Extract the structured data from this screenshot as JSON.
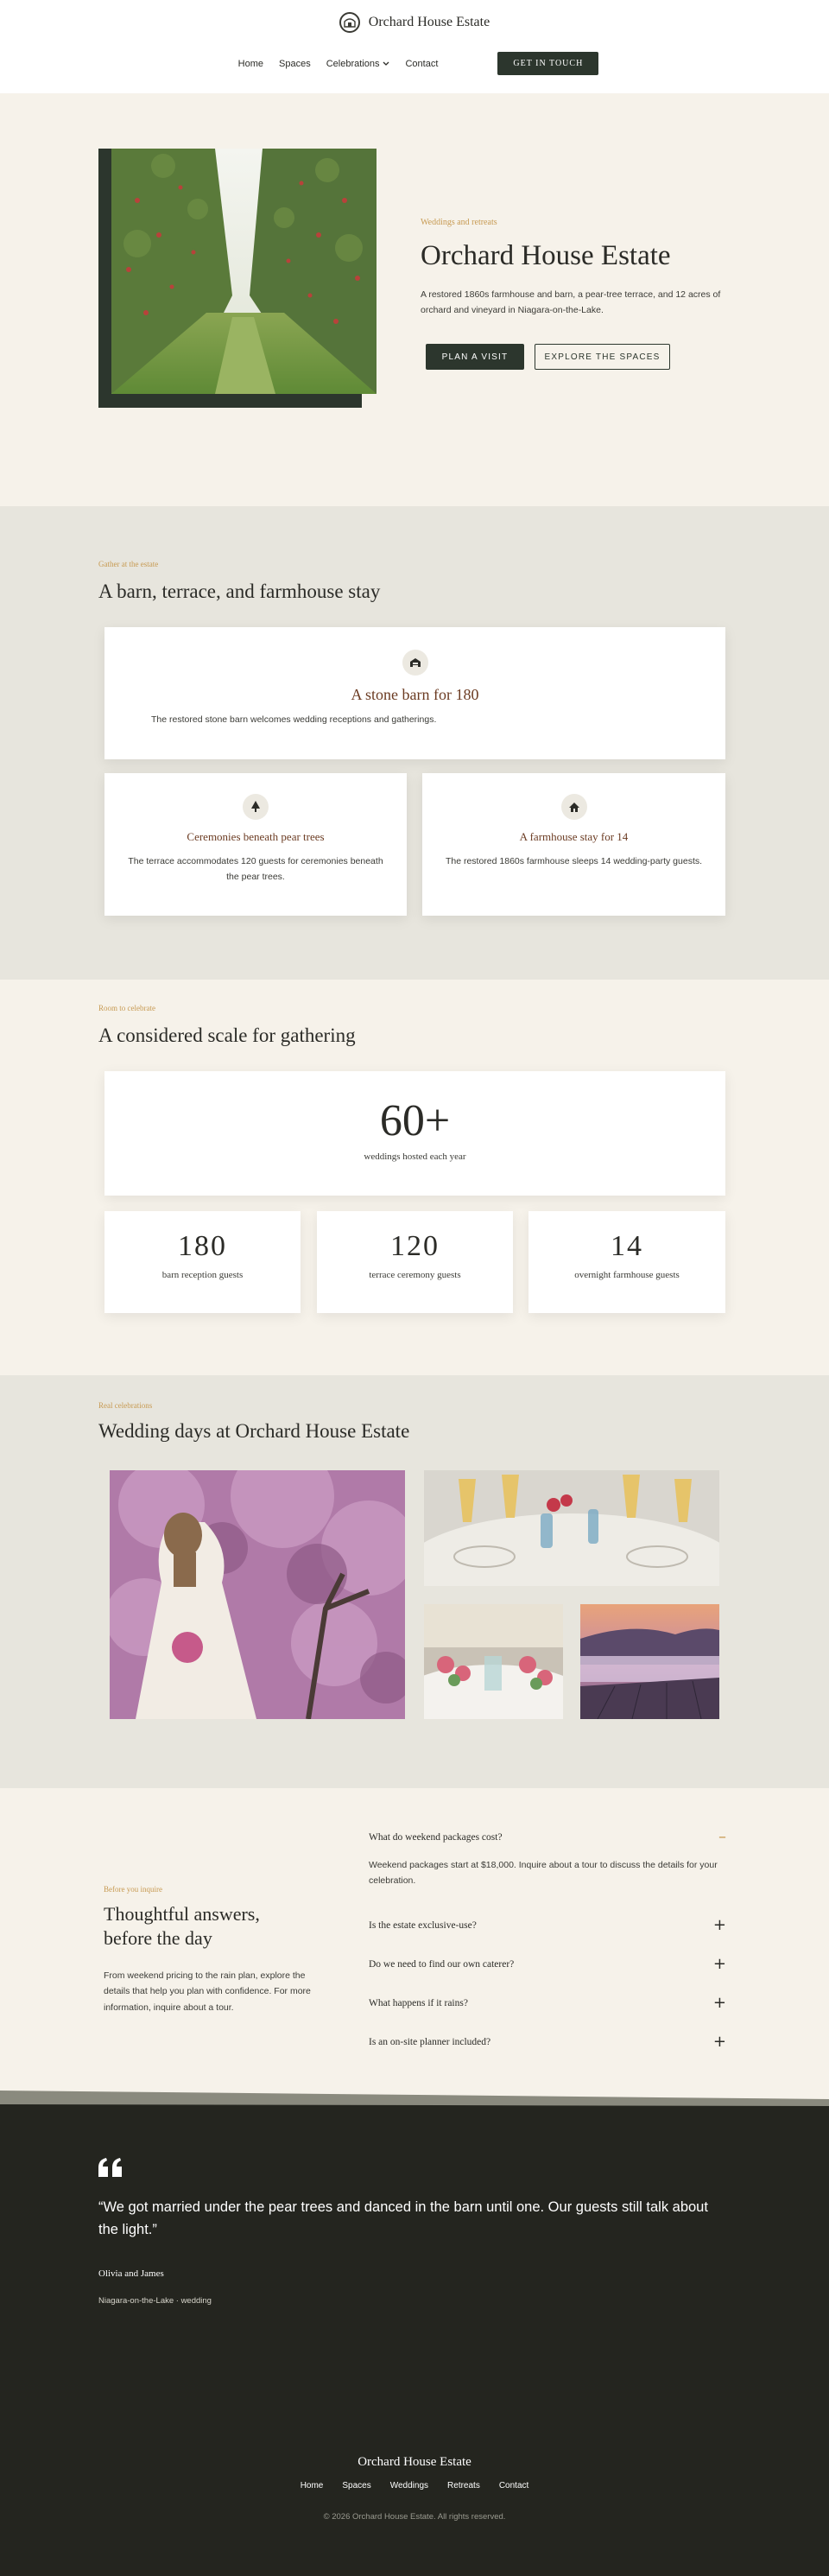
{
  "header": {
    "brand": "Orchard House Estate",
    "logo_icon": "barn-arch-icon",
    "nav": [
      {
        "label": "Home"
      },
      {
        "label": "Spaces"
      },
      {
        "label": "Celebrations"
      },
      {
        "label": "Contact"
      }
    ],
    "cta": "GET IN TOUCH"
  },
  "hero": {
    "eyebrow": "Weddings and retreats",
    "title": "Orchard House Estate",
    "description": "A restored 1860s farmhouse and barn, a pear-tree terrace, and 12 acres of orchard and vineyard in Niagara-on-the-Lake.",
    "primary_button": "PLAN A VISIT",
    "secondary_button": "EXPLORE THE SPACES"
  },
  "features": {
    "eyebrow": "Gather at the estate",
    "title": "A barn, terrace, and farmhouse stay",
    "cards": [
      {
        "icon": "barn-icon",
        "title": "A stone barn for 180",
        "desc": "The restored stone barn welcomes wedding receptions and gatherings."
      },
      {
        "icon": "tree-icon",
        "title": "Ceremonies beneath pear trees",
        "desc": "The terrace accommodates 120 guests for ceremonies beneath the pear trees."
      },
      {
        "icon": "house-icon",
        "title": "A farmhouse stay for 14",
        "desc": "The restored 1860s farmhouse sleeps 14 wedding-party guests."
      }
    ]
  },
  "stats": {
    "eyebrow": "Room to celebrate",
    "title": "A considered scale for gathering",
    "main": {
      "value": "60+",
      "label": "weddings hosted each year"
    },
    "items": [
      {
        "value": "180",
        "label": "barn reception guests"
      },
      {
        "value": "120",
        "label": "terrace ceremony guests"
      },
      {
        "value": "14",
        "label": "overnight farmhouse guests"
      }
    ]
  },
  "gallery": {
    "eyebrow": "Real celebrations",
    "title": "Wedding days at Orchard House Estate"
  },
  "faq": {
    "eyebrow": "Before you inquire",
    "title_line1": "Thoughtful answers,",
    "title_line2": "before the day",
    "intro": "From weekend pricing to the rain plan, explore the details that help you plan with confidence. For more information, inquire about a tour.",
    "items": [
      {
        "q": "What do weekend packages cost?",
        "a": "Weekend packages start at $18,000. Inquire about a tour to discuss the details for your celebration.",
        "open": true,
        "toggle": "–"
      },
      {
        "q": "Is the estate exclusive-use?",
        "toggle": "+"
      },
      {
        "q": "Do we need to find our own caterer?",
        "toggle": "+"
      },
      {
        "q": "What happens if it rains?",
        "toggle": "+"
      },
      {
        "q": "Is an on-site planner included?",
        "toggle": "+"
      }
    ]
  },
  "testimonial": {
    "quote": "“We got married under the pear trees and danced in the barn until one. Our guests still talk about the light.”",
    "author": "Olivia and James",
    "meta": "Niagara-on-the-Lake · wedding"
  },
  "footer": {
    "brand": "Orchard House Estate",
    "links": [
      "Home",
      "Spaces",
      "Weddings",
      "Retreats",
      "Contact"
    ],
    "copyright": "© 2026 Orchard House Estate. All rights reserved."
  },
  "colors": {
    "accent_gold": "#c79a52",
    "forest": "#2c362d",
    "dark_bg": "#24251f",
    "cream": "#f6f2ea",
    "stone": "#e7e5dd"
  }
}
